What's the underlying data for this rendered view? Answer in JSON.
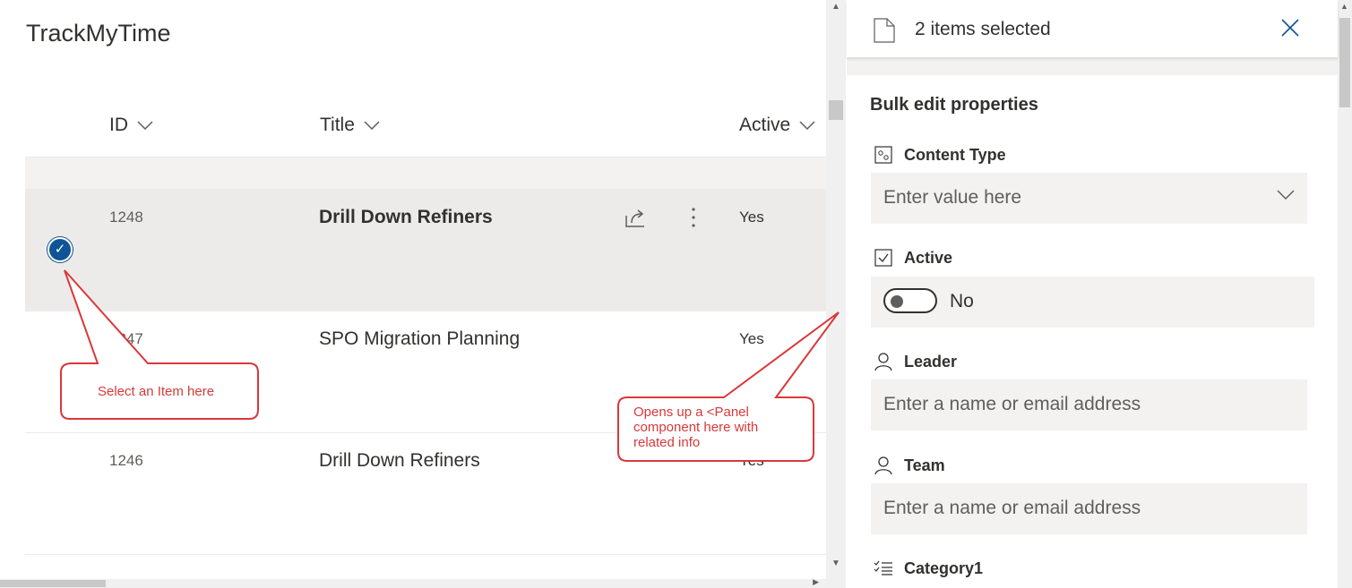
{
  "app": {
    "title": "TrackMyTime"
  },
  "columns": [
    {
      "label": "ID"
    },
    {
      "label": "Title"
    },
    {
      "label": "Active"
    }
  ],
  "rows": [
    {
      "id": "1248",
      "title": "Drill Down Refiners",
      "active": "Yes",
      "selected": true
    },
    {
      "id": "1247",
      "title": "SPO Migration Planning",
      "active": "Yes",
      "selected": false
    },
    {
      "id": "1246",
      "title": "Drill Down Refiners",
      "active": "Yes",
      "selected": false
    }
  ],
  "row_actions": {
    "share_icon": "share-icon",
    "more_icon": "more-vertical-icon"
  },
  "panel": {
    "selection_text": "2 items selected",
    "section_title": "Bulk edit properties",
    "fields": {
      "content_type": {
        "label": "Content Type",
        "placeholder": "Enter value here",
        "icon": "content-type-icon"
      },
      "active": {
        "label": "Active",
        "toggle_text": "No",
        "value": false,
        "icon": "checkbox-icon"
      },
      "leader": {
        "label": "Leader",
        "placeholder": "Enter a name or email address",
        "icon": "person-icon"
      },
      "team": {
        "label": "Team",
        "placeholder": "Enter a name or email address",
        "icon": "person-icon"
      },
      "category1": {
        "label": "Category1",
        "icon": "checklist-icon"
      }
    }
  },
  "callouts": {
    "select_item": "Select an Item here",
    "opens_panel": [
      "Opens up a <Panel",
      "component here with",
      "related info"
    ]
  },
  "colors": {
    "accent": "#0f5596",
    "callout": "#d9383a",
    "selected_row": "#edebe9"
  }
}
